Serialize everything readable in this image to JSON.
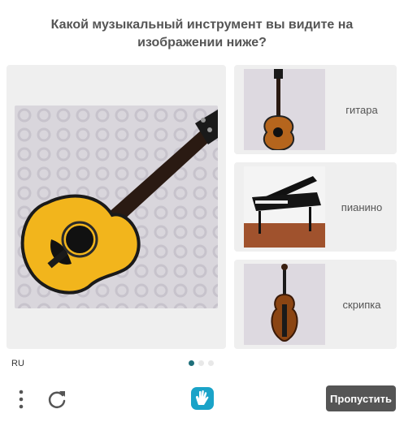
{
  "prompt": "Какой музыкальный инструмент вы видите на изображении ниже?",
  "main_image": {
    "subject": "acoustic guitar"
  },
  "options": [
    {
      "label": "гитара",
      "image": "guitar"
    },
    {
      "label": "пианино",
      "image": "grand-piano"
    },
    {
      "label": "скрипка",
      "image": "violin"
    }
  ],
  "footer": {
    "language": "RU",
    "pagination": {
      "total": 3,
      "active": 1
    },
    "skip_label": "Пропустить"
  },
  "colors": {
    "panel": "#efefef",
    "text": "#555555",
    "skip_bg": "#555555",
    "active_dot": "#1f6f7a",
    "logo": "#1aa3c8"
  }
}
